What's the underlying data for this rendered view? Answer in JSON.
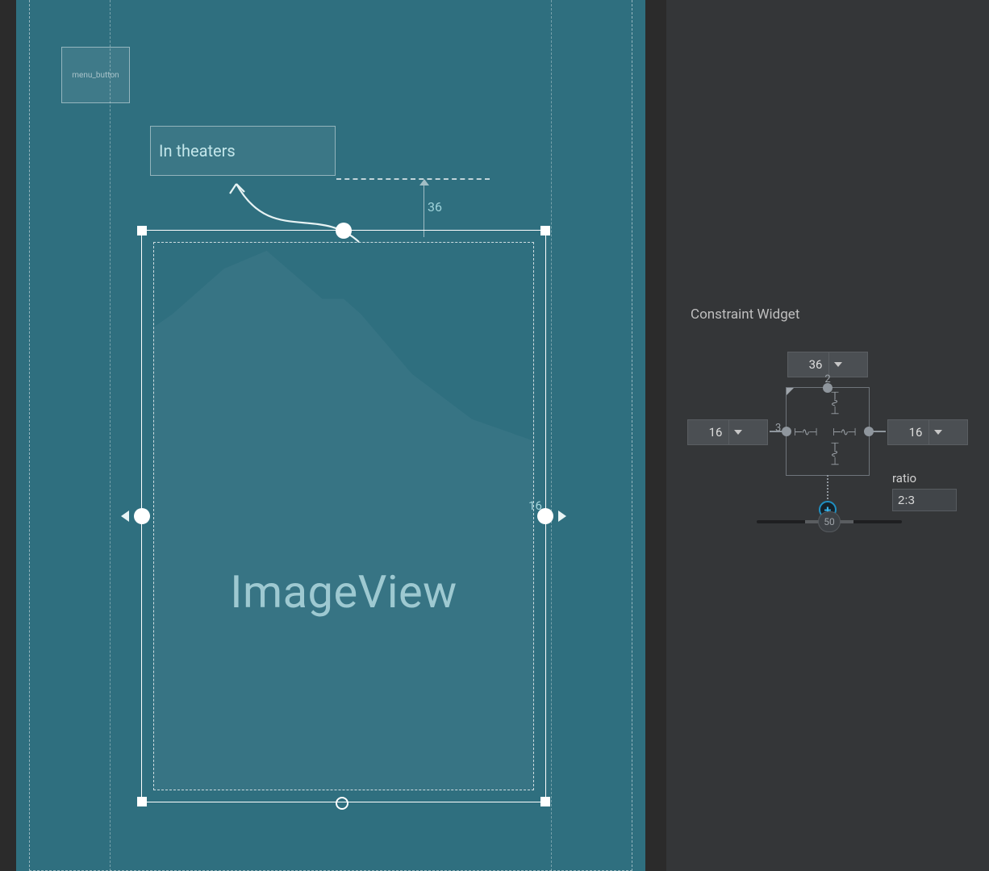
{
  "canvas": {
    "menu_button_label": "menu_button",
    "title_text": "In theaters",
    "top_margin_label": "36",
    "side_margin_label": "16",
    "imageview_label": "ImageView"
  },
  "panel": {
    "heading": "Constraint Widget",
    "margins": {
      "top": "36",
      "left": "16",
      "right": "16"
    },
    "ratio_label": "ratio",
    "ratio_value": "2:3",
    "ratio_nums": {
      "w": "2",
      "h": "3"
    },
    "bias": "50"
  }
}
